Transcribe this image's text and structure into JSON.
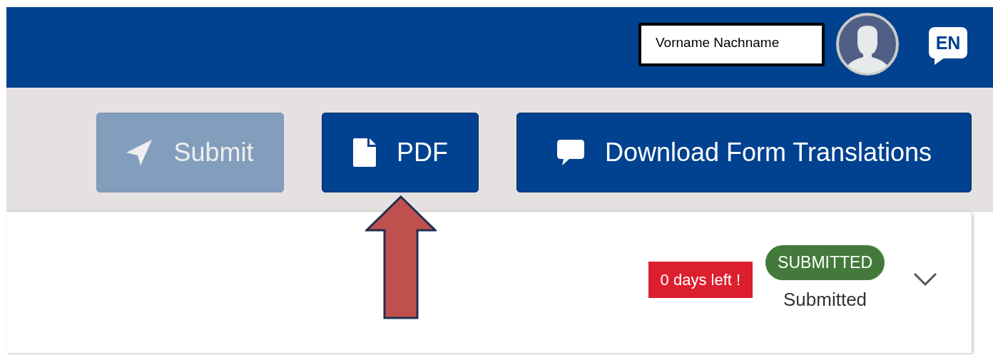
{
  "header": {
    "user_name": "Vorname Nachname",
    "language": "EN"
  },
  "toolbar": {
    "buttons": [
      {
        "label": "Submit",
        "kind": "send",
        "disabled": true
      },
      {
        "label": "PDF",
        "kind": "file",
        "disabled": false
      },
      {
        "label": "Download Form Translations",
        "kind": "comment",
        "disabled": false
      }
    ]
  },
  "card": {
    "deadline": "0 days left !",
    "status_badge": "SUBMITTED",
    "status_text": "Submitted",
    "expanded": false
  }
}
